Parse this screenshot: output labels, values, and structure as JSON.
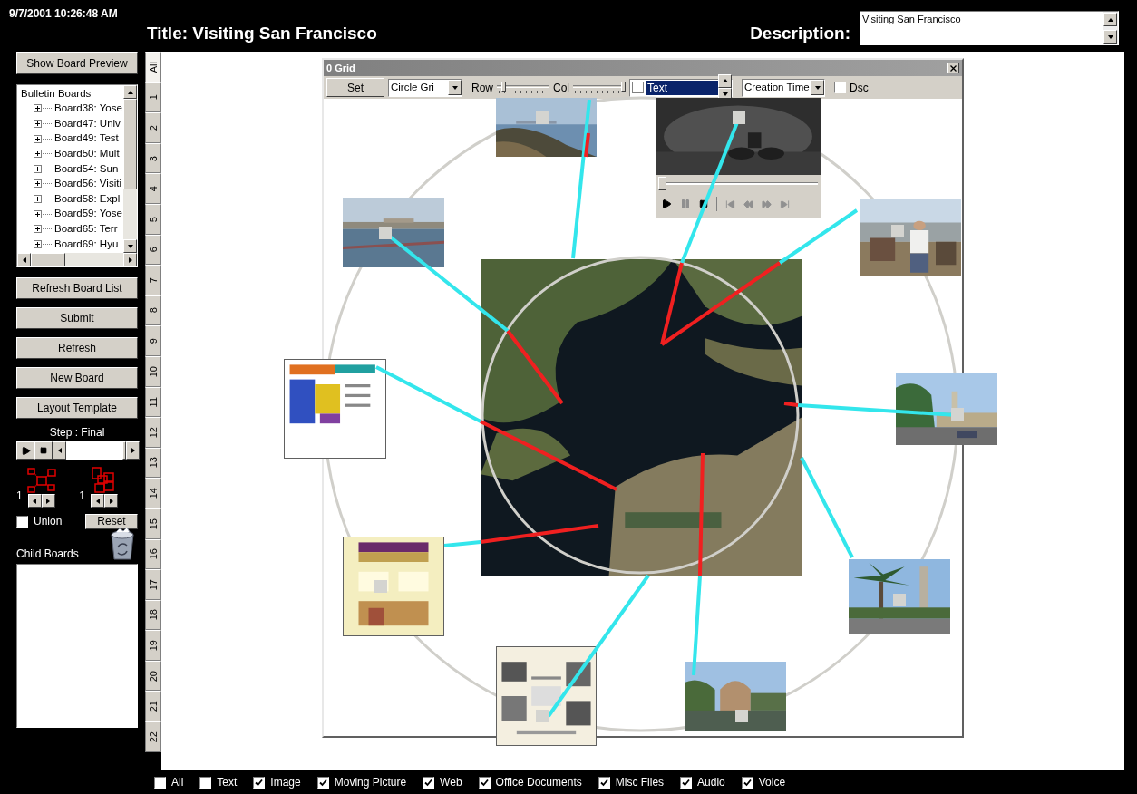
{
  "timestamp": "9/7/2001 10:26:48 AM",
  "title": "Title: Visiting San Francisco",
  "description": {
    "label": "Description:",
    "value": "Visiting San Francisco"
  },
  "sidebar": {
    "preview_button": "Show Board Preview",
    "tree": {
      "root": "Bulletin Boards",
      "items": [
        {
          "label": "Board38: Yose",
          "expanded": false
        },
        {
          "label": "Board47: Univ",
          "expanded": false
        },
        {
          "label": "Board49: Test",
          "expanded": false
        },
        {
          "label": "Board50: Mult",
          "expanded": false
        },
        {
          "label": "Board54: Sun",
          "expanded": false
        },
        {
          "label": "Board56: Visiti",
          "expanded": false
        },
        {
          "label": "Board58: Expl",
          "expanded": false
        },
        {
          "label": "Board59: Yose",
          "expanded": false
        },
        {
          "label": "Board65: Terr",
          "expanded": false
        },
        {
          "label": "Board69: Hyu",
          "expanded": false
        }
      ]
    },
    "buttons": [
      "Refresh Board List",
      "Submit",
      "Refresh",
      "New Board",
      "Layout Template"
    ],
    "step_label": "Step : Final",
    "layouts": [
      {
        "kind": "scatter",
        "count": "1"
      },
      {
        "kind": "stacked",
        "count": "1"
      }
    ],
    "union": {
      "label": "Union",
      "checked": false
    },
    "reset_button": "Reset",
    "child_boards_label": "Child Boards"
  },
  "tabs": [
    {
      "label": "All",
      "selected": true
    },
    {
      "label": "1",
      "selected": false
    },
    {
      "label": "2",
      "selected": false
    },
    {
      "label": "3",
      "selected": false
    },
    {
      "label": "4",
      "selected": false
    },
    {
      "label": "5",
      "selected": false
    },
    {
      "label": "6",
      "selected": false
    },
    {
      "label": "7",
      "selected": false
    },
    {
      "label": "8",
      "selected": false
    },
    {
      "label": "9",
      "selected": false
    },
    {
      "label": "10",
      "selected": false
    },
    {
      "label": "11",
      "selected": false
    },
    {
      "label": "12",
      "selected": false
    },
    {
      "label": "13",
      "selected": false
    },
    {
      "label": "14",
      "selected": false
    },
    {
      "label": "15",
      "selected": false
    },
    {
      "label": "16",
      "selected": false
    },
    {
      "label": "17",
      "selected": false
    },
    {
      "label": "18",
      "selected": false
    },
    {
      "label": "19",
      "selected": false
    },
    {
      "label": "20",
      "selected": false
    },
    {
      "label": "21",
      "selected": false
    },
    {
      "label": "22",
      "selected": false
    }
  ],
  "grid_window": {
    "title": "0 Grid",
    "set_button": "Set",
    "layout_select": "Circle Gri",
    "row_label": "Row",
    "row_slider": {
      "level": 0.1
    },
    "col_label": "Col",
    "col_slider": {
      "level": 1
    },
    "text_filter": {
      "checked": false,
      "value": "Text"
    },
    "sort_select": "Creation Time",
    "dsc": {
      "label": "Dsc",
      "checked": false
    },
    "video_position": {
      "level": 0
    }
  },
  "filters": [
    {
      "label": "All",
      "checked": false
    },
    {
      "label": "Text",
      "checked": false
    },
    {
      "label": "Image",
      "checked": true
    },
    {
      "label": "Moving Picture",
      "checked": true
    },
    {
      "label": "Web",
      "checked": true
    },
    {
      "label": "Office Documents",
      "checked": true
    },
    {
      "label": "Misc Files",
      "checked": true
    },
    {
      "label": "Audio",
      "checked": true
    },
    {
      "label": "Voice",
      "checked": true
    }
  ]
}
